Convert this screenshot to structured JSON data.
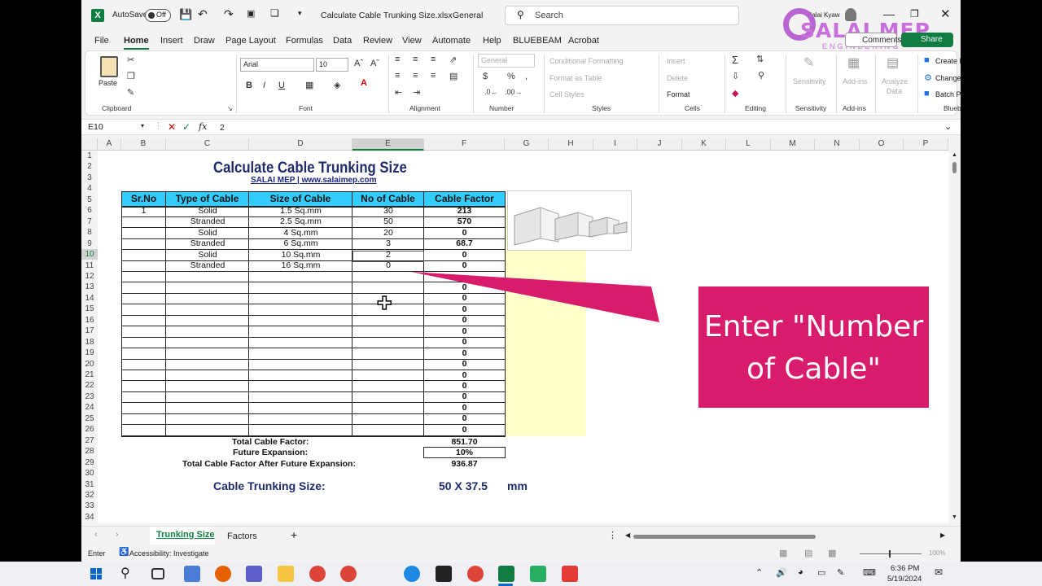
{
  "titlebar": {
    "autosave_label": "AutoSave",
    "autosave_state": "Off",
    "file_name": "Calculate Cable Trunking Size.xlsx",
    "sensitivity": "General",
    "search_placeholder": "Search",
    "user_name": "Salai Kyaw"
  },
  "watermark": {
    "line1": "SALAI MEP",
    "line2": "ENGINEERING"
  },
  "menu": [
    "File",
    "Home",
    "Insert",
    "Draw",
    "Page Layout",
    "Formulas",
    "Data",
    "Review",
    "View",
    "Automate",
    "Help",
    "BLUEBEAM",
    "Acrobat"
  ],
  "actions": {
    "comments": "Comments",
    "share": "Share"
  },
  "ribbon": {
    "clipboard": {
      "paste": "Paste",
      "label": "Clipboard"
    },
    "font": {
      "name": "Arial",
      "size": "10",
      "label": "Font",
      "bold": "B",
      "italic": "I",
      "underline": "U"
    },
    "alignment": {
      "label": "Alignment"
    },
    "number": {
      "format": "General",
      "label": "Number",
      "dollar": "$",
      "percent": "%"
    },
    "styles": {
      "conditional": "Conditional Formatting",
      "format_table": "Format as Table",
      "cell_styles": "Cell Styles",
      "label": "Styles"
    },
    "cells": {
      "insert": "Insert",
      "delete": "Delete",
      "format": "Format",
      "label": "Cells"
    },
    "editing": {
      "label": "Editing"
    },
    "sensitivity": {
      "btn": "Sensitivity",
      "label": "Sensitivity"
    },
    "addins": {
      "btn": "Add-ins",
      "label": "Add-ins"
    },
    "analyze": {
      "btn1": "Analyze",
      "btn2": "Data"
    },
    "bluebeam": {
      "create_pdf": "Create PDF",
      "change_settings": "Change Settings",
      "batch_pdf": "Batch PDF",
      "label": "Bluebeam"
    }
  },
  "formula_bar": {
    "name_box": "E10",
    "fx": "fx",
    "value": "2"
  },
  "columns": [
    "A",
    "B",
    "C",
    "D",
    "E",
    "F",
    "G",
    "H",
    "I",
    "J",
    "K",
    "L",
    "M",
    "N",
    "O",
    "P"
  ],
  "rows": [
    "1",
    "2",
    "3",
    "4",
    "5",
    "6",
    "7",
    "8",
    "9",
    "10",
    "11",
    "12",
    "13",
    "14",
    "15",
    "16",
    "17",
    "18",
    "19",
    "20",
    "21",
    "22",
    "23",
    "24",
    "25",
    "26",
    "27",
    "28",
    "29",
    "30",
    "31",
    "32",
    "33",
    "34"
  ],
  "sheet": {
    "title": "Calculate Cable Trunking Size",
    "subtitle": "SALAI MEP | www.salaimep.com",
    "headers": [
      "Sr.No",
      "Type of Cable",
      "Size of Cable",
      "No of Cable",
      "Cable Factor"
    ],
    "data_rows": [
      [
        "1",
        "Solid",
        "1.5 Sq.mm",
        "30",
        "213"
      ],
      [
        "",
        "Stranded",
        "2.5 Sq.mm",
        "50",
        "570"
      ],
      [
        "",
        "Solid",
        "4 Sq.mm",
        "20",
        "0"
      ],
      [
        "",
        "Stranded",
        "6 Sq.mm",
        "3",
        "68.7"
      ],
      [
        "",
        "Solid",
        "10 Sq.mm",
        "2",
        "0"
      ],
      [
        "",
        "Stranded",
        "16 Sq.mm",
        "0",
        "0"
      ]
    ],
    "factor_zeros": [
      "0",
      "0",
      "0",
      "0",
      "0",
      "0",
      "0",
      "0",
      "0",
      "0",
      "0",
      "0",
      "0",
      "0"
    ],
    "total_label": "Total Cable Factor:",
    "total_value": "851.70",
    "future_label": "Future Expansion:",
    "future_value": "10%",
    "after_label": "Total Cable Factor After Future Expansion:",
    "after_value": "936.87",
    "size_label": "Cable Trunking Size:",
    "size_value": "50 X 37.5",
    "size_unit": "mm"
  },
  "callout": {
    "line1": "Enter \"Number",
    "line2": "of Cable\""
  },
  "tabs": [
    "Trunking Size",
    "Factors"
  ],
  "status": {
    "mode": "Enter",
    "accessibility": "Accessibility: Investigate",
    "zoom": "100%"
  },
  "clock": {
    "time": "6:36 PM",
    "date": "5/19/2024"
  },
  "colors": {
    "header_fill": "#33ccff",
    "factor_fill": "#ffffcc",
    "callout": "#d81b6a",
    "excel_green": "#107c41"
  }
}
